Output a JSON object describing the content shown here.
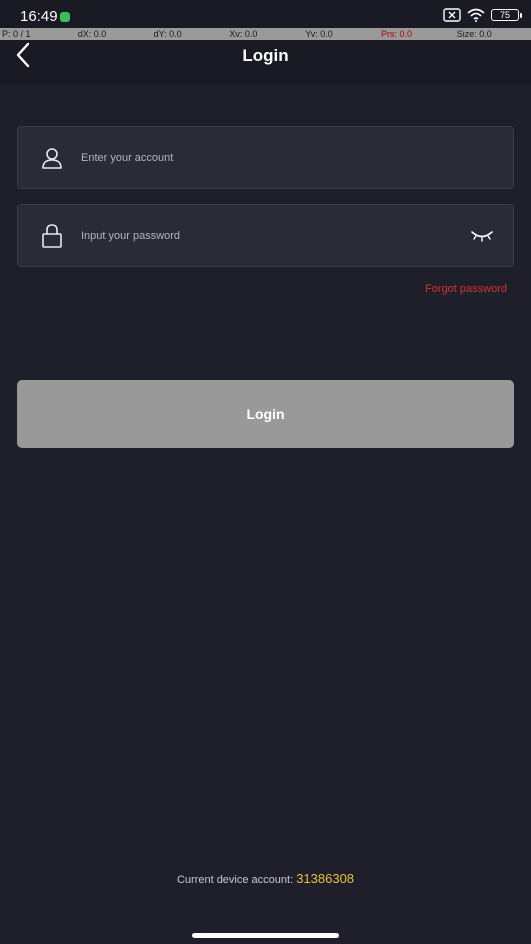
{
  "status_bar": {
    "time": "16:49",
    "battery_level": "75",
    "icons": [
      "sim-icon",
      "wifi-icon",
      "battery-icon"
    ]
  },
  "debug_bar": {
    "p": "P: 0 / 1",
    "dx": "dX: 0.0",
    "dy": "dY: 0.0",
    "xv": "Xv: 0.0",
    "yv": "Yv: 0.0",
    "prs": "Prs: 0.0",
    "size": "Size: 0.0"
  },
  "header": {
    "title": "Login",
    "back_icon": "chevron-left-icon"
  },
  "form": {
    "account_placeholder": "Enter your account",
    "password_placeholder": "Input your password",
    "account_icon": "user-icon",
    "password_icon": "lock-icon",
    "eye_icon": "eye-closed-icon",
    "forgot_label": "Forgot password",
    "login_label": "Login"
  },
  "footer": {
    "device_account_label": "Current device account:",
    "device_account_value": "31386308"
  },
  "colors": {
    "background": "#1f1f2b",
    "field_background": "#2b2b37",
    "button_disabled": "#999999",
    "forgot_link": "#d0342c",
    "account_number": "#e8c23a"
  }
}
